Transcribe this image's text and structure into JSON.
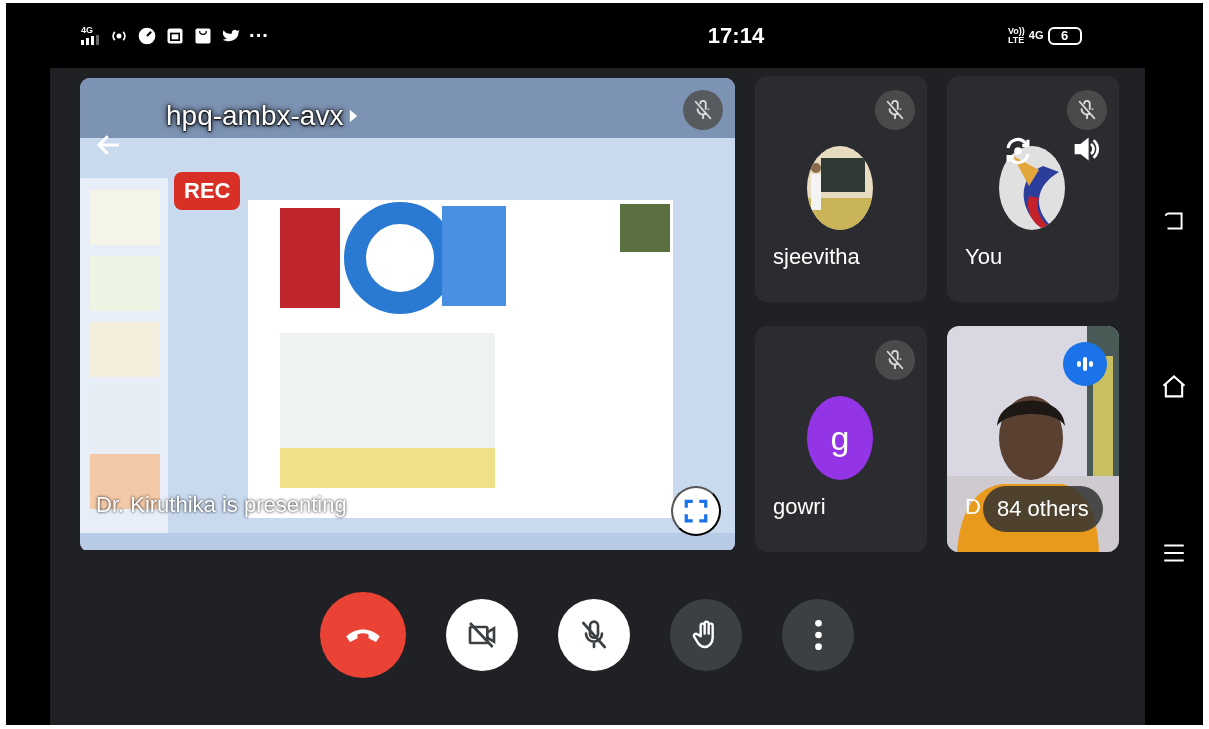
{
  "status_bar": {
    "network": "4G",
    "overflow": "···",
    "time": "17:14",
    "volte": "Vo))",
    "lte": "LTE",
    "network_right": "4G",
    "battery": "6"
  },
  "presentation": {
    "kind": "picture",
    "meeting_code": "hpq-ambx-avx",
    "recording": "REC",
    "presenter": "Dr. Kiruthika is presenting",
    "muted": true
  },
  "tiles": [
    {
      "kind": "avatar",
      "name": "sjeevitha",
      "muted": true
    },
    {
      "kind": "self",
      "name": "You",
      "muted": true
    },
    {
      "kind": "initial",
      "name": "gowri",
      "initial": "g",
      "color": "#9334e6",
      "muted": true
    },
    {
      "kind": "video",
      "name": "D",
      "speaking": true,
      "overlay": "84 others"
    }
  ],
  "controls": [
    {
      "kind": "end_call"
    },
    {
      "kind": "camera",
      "on": false
    },
    {
      "kind": "mic",
      "on": false
    },
    {
      "kind": "hand"
    },
    {
      "kind": "more"
    }
  ]
}
